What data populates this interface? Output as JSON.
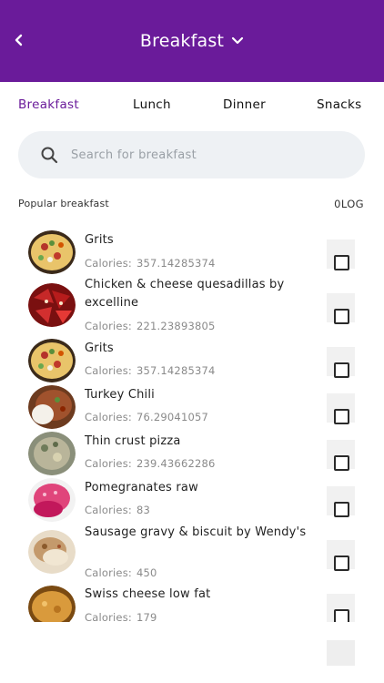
{
  "header": {
    "title": "Breakfast"
  },
  "tabs": [
    {
      "label": "Breakfast",
      "active": true
    },
    {
      "label": "Lunch",
      "active": false
    },
    {
      "label": "Dinner",
      "active": false
    },
    {
      "label": "Snacks",
      "active": false
    }
  ],
  "search": {
    "placeholder": "Search for breakfast",
    "value": ""
  },
  "section": {
    "label": "Popular breakfast",
    "log_label": "0LOG"
  },
  "foods": [
    {
      "name": "Grits",
      "calories_label": "Calories:",
      "calories": "357.14285374",
      "checked": false
    },
    {
      "name": "Chicken & cheese quesadillas by excelline",
      "calories_label": "Calories:",
      "calories": "221.23893805",
      "checked": false
    },
    {
      "name": "Grits",
      "calories_label": "Calories:",
      "calories": "357.14285374",
      "checked": false
    },
    {
      "name": "Turkey Chili",
      "calories_label": "Calories:",
      "calories": "76.29041057",
      "checked": false
    },
    {
      "name": "Thin crust pizza",
      "calories_label": "Calories:",
      "calories": "239.43662286",
      "checked": false
    },
    {
      "name": "Pomegranates raw",
      "calories_label": "Calories:",
      "calories": "83",
      "checked": false
    },
    {
      "name": "Sausage gravy & biscuit by Wendy's",
      "calories_label": "Calories:",
      "calories": "450",
      "checked": false
    },
    {
      "name": "Swiss cheese low fat",
      "calories_label": "Calories:",
      "calories": "179",
      "checked": false
    }
  ],
  "colors": {
    "accent": "#6a1b9a",
    "search_bg": "#eef1f4"
  },
  "icons": {
    "back": "chevron-left-icon",
    "title_dropdown": "chevron-down-icon",
    "search": "search-icon"
  }
}
